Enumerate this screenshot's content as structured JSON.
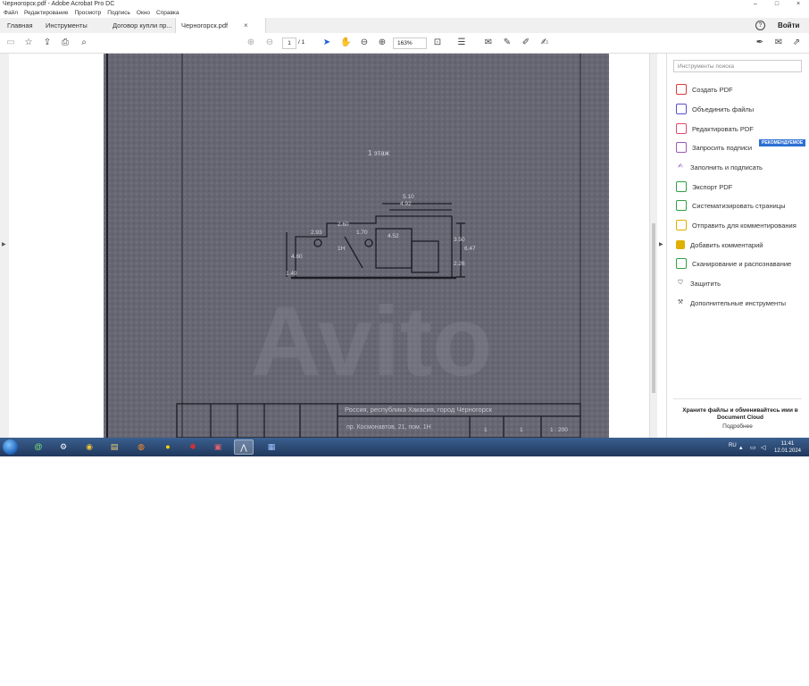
{
  "window": {
    "title": "Черногорск.pdf - Adobe Acrobat Pro DC",
    "controls": [
      "–",
      "□",
      "×"
    ]
  },
  "menu": [
    "Файл",
    "Редактирование",
    "Просмотр",
    "Подпись",
    "Окно",
    "Справка"
  ],
  "tabs": {
    "home": "Главная",
    "tools": "Инструменты",
    "doc1": "Договор купли пр...",
    "doc2": "Черногорск.pdf",
    "close": "×",
    "help": "?",
    "signin": "Войти"
  },
  "toolbar": {
    "page_current": "1",
    "page_total": "/ 1",
    "zoom": "163%"
  },
  "document": {
    "floor_label": "1 этаж",
    "dims": [
      "5.10",
      "4.92",
      "2.60",
      "2.93",
      "1.70",
      "4.52",
      "4.80",
      "1.49",
      "6.47",
      "3.50",
      "2.26"
    ],
    "room_label": "1Н",
    "address_line1": "Россия, республика Хакасия, город Черногорск",
    "address_line2": "пр. Космонавтов, 21, пом. 1Н",
    "sheet_cells": [
      "1",
      "1",
      "1 : 200"
    ],
    "watermark": "Avito"
  },
  "right_panel": {
    "search_placeholder": "Инструменты поиска",
    "badge": "РЕКОМЕНДУЕМОЕ",
    "items": [
      {
        "label": "Создать PDF",
        "icon": "create-pdf-icon",
        "color": "#d9383a"
      },
      {
        "label": "Объединить файлы",
        "icon": "combine-files-icon",
        "color": "#5a4fcf"
      },
      {
        "label": "Редактировать PDF",
        "icon": "edit-pdf-icon",
        "color": "#e04a6a"
      },
      {
        "label": "Запросить подписи",
        "icon": "request-signatures-icon",
        "color": "#9b59b6"
      },
      {
        "label": "Заполнить и подписать",
        "icon": "fill-sign-icon",
        "color": "#7a4bbf"
      },
      {
        "label": "Экспорт PDF",
        "icon": "export-pdf-icon",
        "color": "#2ea043"
      },
      {
        "label": "Систематизировать страницы",
        "icon": "organize-pages-icon",
        "color": "#2ea043"
      },
      {
        "label": "Отправить для комментирования",
        "icon": "send-for-comments-icon",
        "color": "#e0b000"
      },
      {
        "label": "Добавить комментарий",
        "icon": "comment-icon",
        "color": "#e0b000"
      },
      {
        "label": "Сканирование и распознавание",
        "icon": "scan-ocr-icon",
        "color": "#2ea043"
      },
      {
        "label": "Защитить",
        "icon": "protect-icon",
        "color": "#555555"
      },
      {
        "label": "Дополнительные инструменты",
        "icon": "more-tools-icon",
        "color": "#555555"
      }
    ],
    "footer_title": "Храните файлы и обменивайтесь ими в Document Cloud",
    "footer_link": "Подробнее"
  },
  "taskbar": {
    "language": "RU",
    "time": "11:41",
    "date": "12.01.2024"
  }
}
